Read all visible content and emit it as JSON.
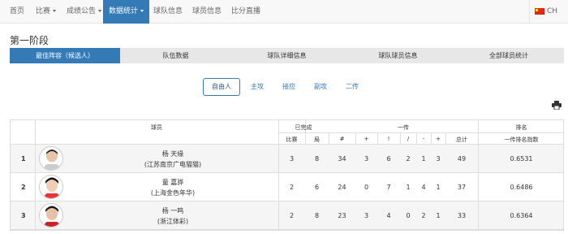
{
  "nav": {
    "items": [
      {
        "label": "首页"
      },
      {
        "label": "比赛"
      },
      {
        "label": "成绩公告"
      },
      {
        "label": "数据统计"
      },
      {
        "label": "球队信息"
      },
      {
        "label": "球员信息"
      },
      {
        "label": "比分直播"
      }
    ],
    "lang": "CH"
  },
  "stage_title": "第一阶段",
  "tabs": [
    "最佳阵容（候选人）",
    "队伍数据",
    "球队详细信息",
    "球队球员信息",
    "全部球员统计"
  ],
  "subtabs": [
    "自由人",
    "主攻",
    "接应",
    "副攻",
    "二传"
  ],
  "table": {
    "headers": {
      "player": "球员",
      "completed": "已完成",
      "first_pass": "一传",
      "ranking": "排名",
      "matches": "比赛",
      "sets": "局",
      "hash": "#",
      "plus": "+",
      "excl": "!",
      "slash": "/",
      "minus": "-",
      "plus2": "+",
      "total": "总计",
      "index": "一传排名指数"
    },
    "rows": [
      {
        "rank": "1",
        "name": "杨 天缘",
        "team": "(江苏南京广电猫猫)",
        "matches": "3",
        "sets": "8",
        "hash": "34",
        "plus": "3",
        "excl": "6",
        "slash": "2",
        "minus": "1",
        "plus2": "3",
        "total": "49",
        "index": "0.6531"
      },
      {
        "rank": "2",
        "name": "童 嘉骅",
        "team": "(上海金色年华)",
        "matches": "2",
        "sets": "6",
        "hash": "24",
        "plus": "0",
        "excl": "7",
        "slash": "1",
        "minus": "4",
        "plus2": "1",
        "total": "37",
        "index": "0.6486"
      },
      {
        "rank": "3",
        "name": "杨 一鸣",
        "team": "(浙江体彩)",
        "matches": "2",
        "sets": "8",
        "hash": "23",
        "plus": "3",
        "excl": "4",
        "slash": "0",
        "minus": "2",
        "plus2": "1",
        "total": "33",
        "index": "0.6364"
      }
    ]
  }
}
